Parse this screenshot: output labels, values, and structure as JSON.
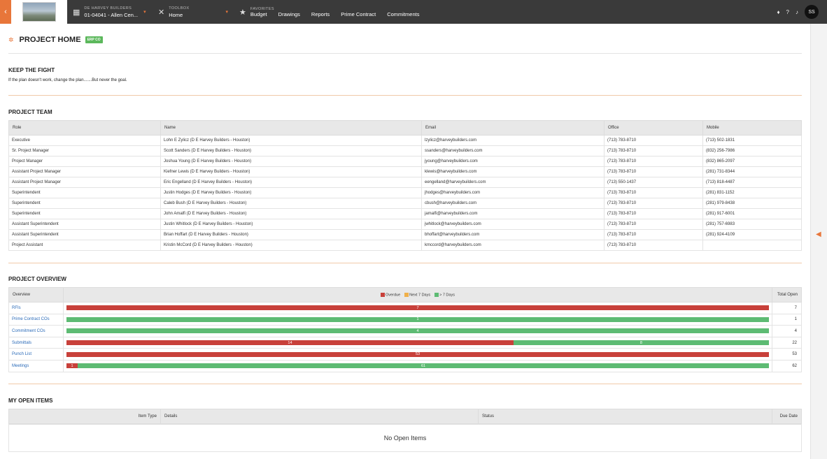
{
  "nav": {
    "company": "DE HARVEY BUILDERS",
    "project": "01-04041 - Allen Cen...",
    "toolbox_label": "TOOLBOX",
    "toolbox_value": "Home",
    "favorites_label": "FAVORITES",
    "favorites": [
      "Budget",
      "Drawings",
      "Reports",
      "Prime Contract",
      "Commitments"
    ],
    "avatar": "SS"
  },
  "page": {
    "title": "PROJECT HOME",
    "badge": "ERP CO"
  },
  "motto": {
    "title": "KEEP THE FIGHT",
    "text": "If the plan doesn't work, change the plan.......But never the goal."
  },
  "team": {
    "title": "PROJECT TEAM",
    "headers": [
      "Role",
      "Name",
      "Email",
      "Office",
      "Mobile"
    ],
    "rows": [
      [
        "Executive",
        "Lohn E Zylicz (D E Harvey Builders - Houston)",
        "lzylicz@harveybuilders.com",
        "(713) 783-8710",
        "(713) 502-1831"
      ],
      [
        "Sr. Project Manager",
        "Scott Sanders (D E Harvey Builders - Houston)",
        "ssanders@harveybuilders.com",
        "(713) 783-8710",
        "(832) 256-7986"
      ],
      [
        "Project Manager",
        "Joshua Young (D E Harvey Builders - Houston)",
        "jyoung@harveybuilders.com",
        "(713) 783-8710",
        "(832) 865-2097"
      ],
      [
        "Assistant Project Manager",
        "Kiefner Lewis (D E Harvey Builders - Houston)",
        "klewis@harveybuilders.com",
        "(713) 783-8710",
        "(281) 731-8344"
      ],
      [
        "Assistant Project Manager",
        "Eric Engelland (D E Harvey Builders - Houston)",
        "eengelland@harveybuilders.com",
        "(713) 550-1437",
        "(713) 818-4487"
      ],
      [
        "Superintendent",
        "Justin Hodges (D E Harvey Builders - Houston)",
        "jhodges@harveybuilders.com",
        "(713) 783-8710",
        "(281) 831-1152"
      ],
      [
        "Superintendent",
        "Caleb Bush (D E Harvey Builders - Houston)",
        "cbush@harveybuilders.com",
        "(713) 783-8710",
        "(281) 979-8438"
      ],
      [
        "Superintendent",
        "John Amalfi (D E Harvey Builders - Houston)",
        "jamalfi@harveybuilders.com",
        "(713) 783-8710",
        "(281) 917-6001"
      ],
      [
        "Assistant Superintendent",
        "Justin Whitlock (D E Harvey Builders - Houston)",
        "jwhitlock@harveybuilders.com",
        "(713) 783-8710",
        "(281) 757-6983"
      ],
      [
        "Assistant Superintendent",
        "Brian Hoffart (D E Harvey Builders - Houston)",
        "bhoffart@harveybuilders.com",
        "(713) 783-8710",
        "(281) 924-4109"
      ],
      [
        "Project Assistant",
        "Kristin McCord (D E Harvey Builders - Houston)",
        "kmccord@harveybuilders.com",
        "(713) 783-8710",
        ""
      ]
    ]
  },
  "overview": {
    "title": "PROJECT OVERVIEW",
    "col_overview": "Overview",
    "col_total": "Total Open",
    "legend": [
      {
        "label": "Overdue",
        "color": "#c8403a"
      },
      {
        "label": "Next 7 Days",
        "color": "#f0b04a"
      },
      {
        "label": "> 7 Days",
        "color": "#5dbb73"
      }
    ],
    "rows": [
      {
        "name": "RFIs",
        "overdue": 7,
        "next7": 0,
        "later": 0,
        "total": "7"
      },
      {
        "name": "Prime Contract COs",
        "overdue": 0,
        "next7": 0,
        "later": 1,
        "total": "1"
      },
      {
        "name": "Commitment COs",
        "overdue": 0,
        "next7": 0,
        "later": 4,
        "total": "4"
      },
      {
        "name": "Submittals",
        "overdue": 14,
        "next7": 0,
        "later": 8,
        "total": "22"
      },
      {
        "name": "Punch List",
        "overdue": 53,
        "next7": 0,
        "later": 0,
        "total": "53"
      },
      {
        "name": "Meetings",
        "overdue": 1,
        "next7": 0,
        "later": 61,
        "total": "62"
      }
    ]
  },
  "open_items": {
    "title": "MY OPEN ITEMS",
    "headers": [
      "Item Type",
      "Details",
      "Status",
      "Due Date"
    ],
    "empty_text": "No Open Items"
  }
}
